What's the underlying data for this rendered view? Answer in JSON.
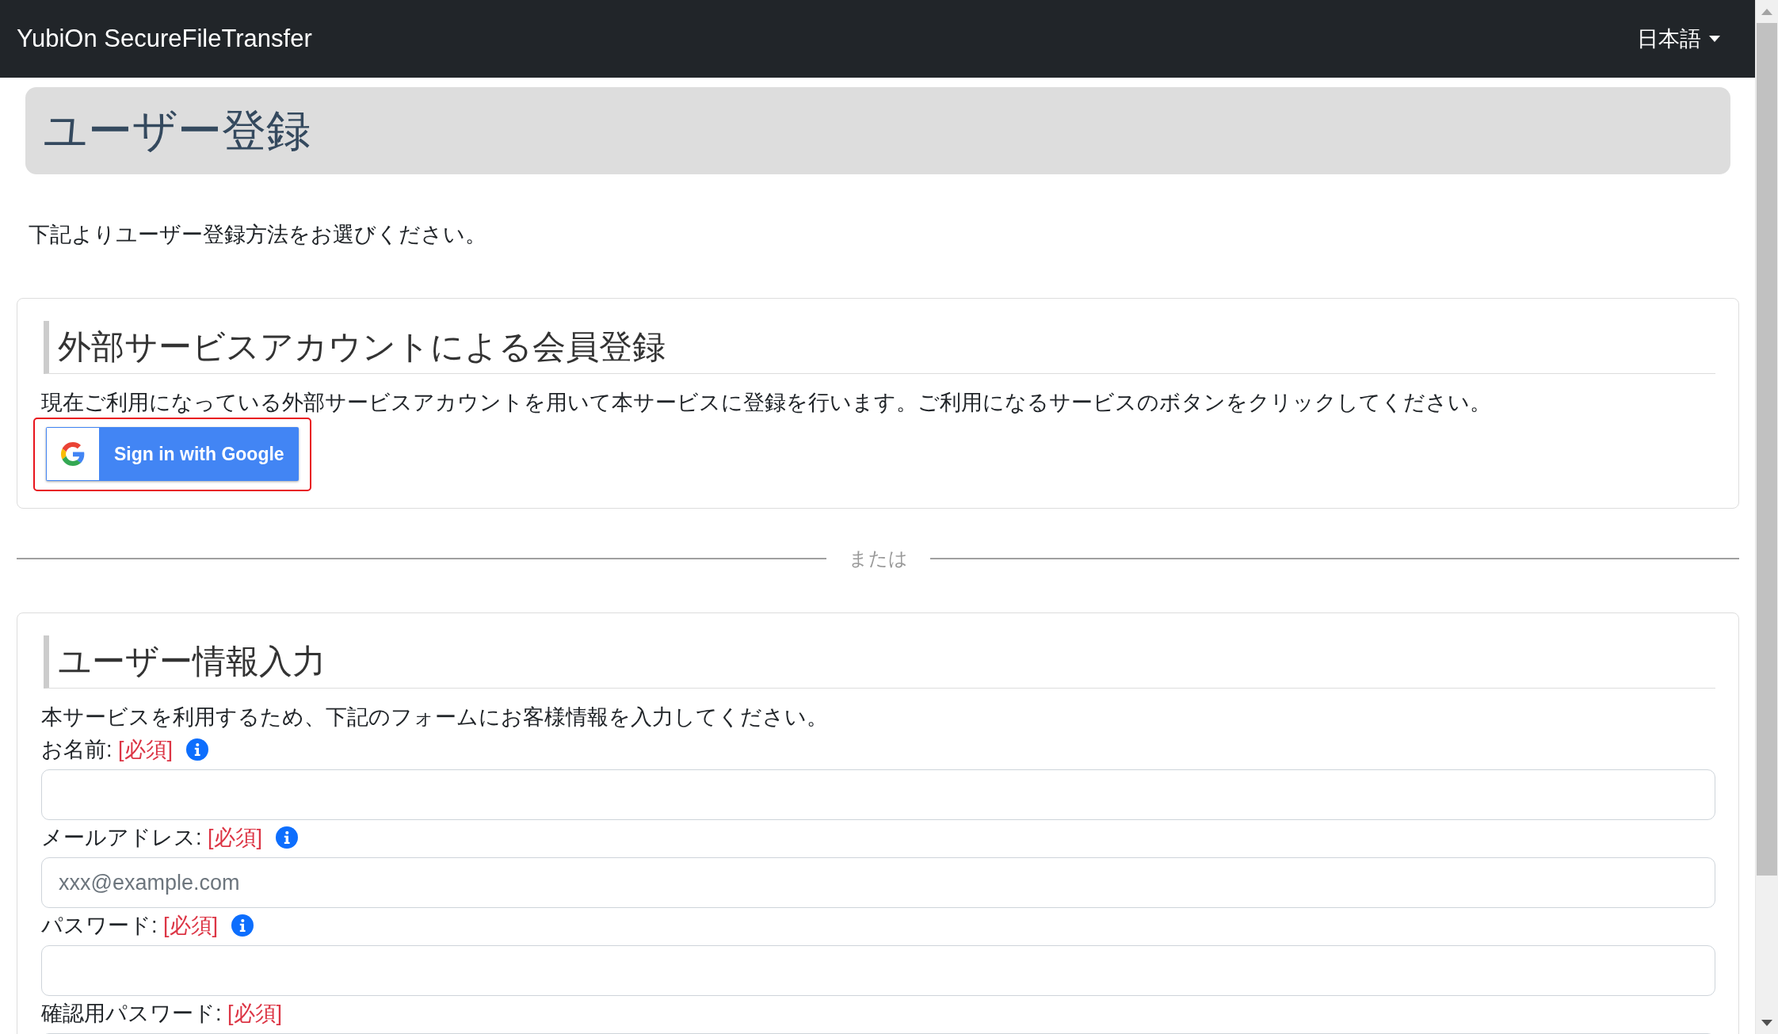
{
  "navbar": {
    "brand": "YubiOn SecureFileTransfer",
    "language": "日本語"
  },
  "page_header": {
    "title": "ユーザー登録"
  },
  "intro": "下記よりユーザー登録方法をお選びください。",
  "external_signup": {
    "heading": "外部サービスアカウントによる会員登録",
    "description": "現在ご利用になっている外部サービスアカウントを用いて本サービスに登録を行います。ご利用になるサービスのボタンをクリックしてください。",
    "google_button": {
      "label": "Sign in with Google",
      "highlighted": true
    }
  },
  "divider": {
    "label": "または"
  },
  "user_info_form": {
    "heading": "ユーザー情報入力",
    "description": "本サービスを利用するため、下記のフォームにお客様情報を入力してください。",
    "fields": [
      {
        "label": "お名前:",
        "required_mark": "[必須]",
        "info_icon": true
      },
      {
        "label": "メールアドレス:",
        "required_mark": "[必須]",
        "info_icon": true,
        "placeholder": "xxx@example.com"
      },
      {
        "label": "パスワード:",
        "required_mark": "[必須]",
        "info_icon": true
      },
      {
        "label": "確認用パスワード:",
        "required_mark": "[必須]",
        "info_icon": false
      }
    ]
  }
}
